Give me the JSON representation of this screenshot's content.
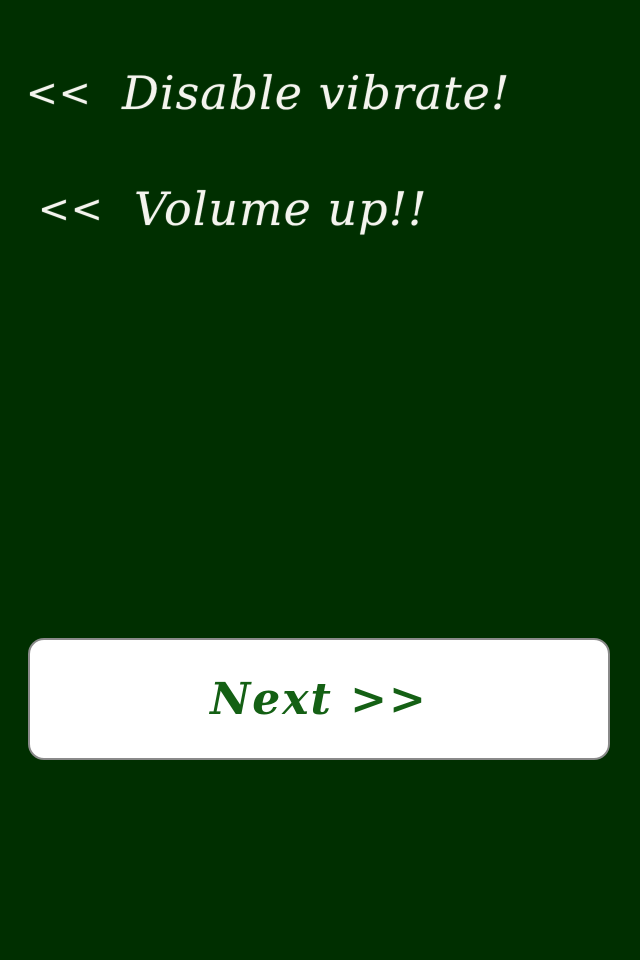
{
  "background_color": "#002f00",
  "hints": [
    {
      "arrow": "<<",
      "text": "Disable vibrate!"
    },
    {
      "arrow": "<<",
      "text": "Volume up!!"
    }
  ],
  "next_button": {
    "label": "Next >>",
    "text_color": "#146014"
  }
}
